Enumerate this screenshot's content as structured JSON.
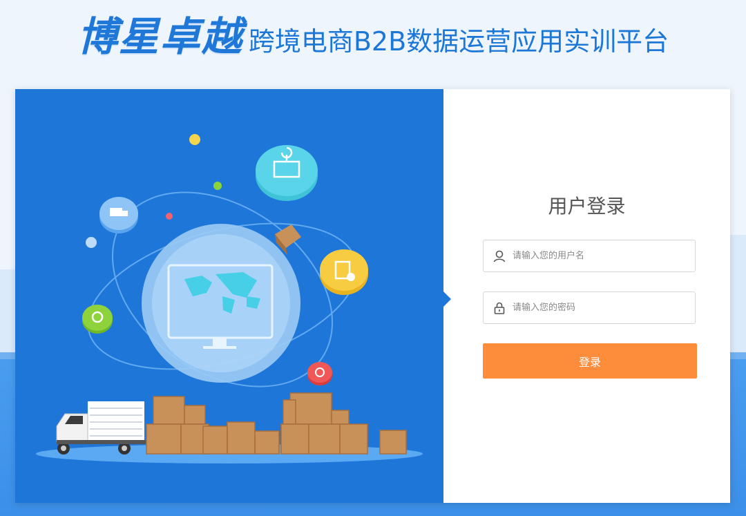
{
  "header": {
    "brand": "博星卓越",
    "subtitle": "跨境电商B2B数据运营应用实训平台"
  },
  "login": {
    "title": "用户登录",
    "username_placeholder": "请输入您的用户名",
    "password_placeholder": "请输入您的密码",
    "submit_label": "登录"
  },
  "colors": {
    "brand_blue": "#1e77d8",
    "button_orange": "#fd8c3b"
  },
  "icons": {
    "username": "user-icon",
    "password": "lock-icon"
  }
}
